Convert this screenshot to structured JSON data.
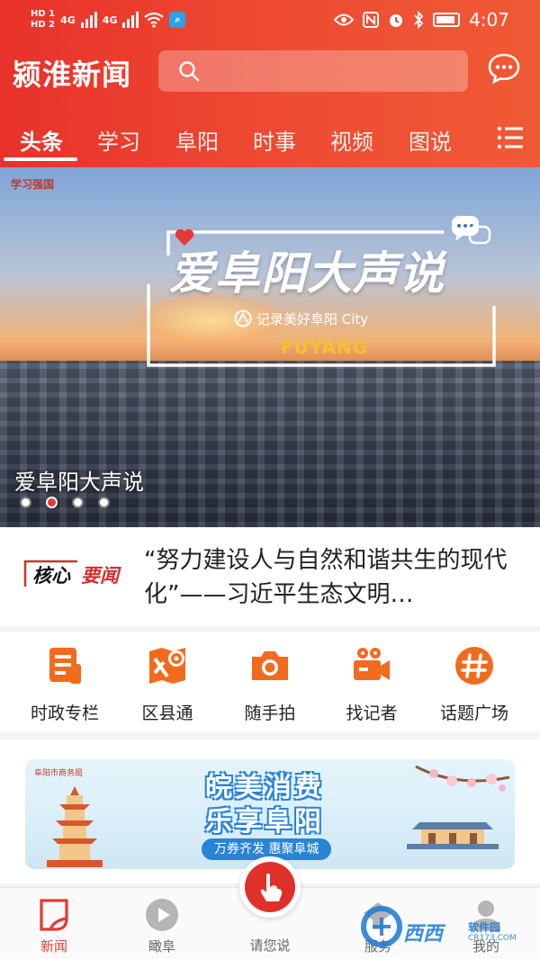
{
  "status_bar": {
    "hd1": "HD 1",
    "hd2": "HD 2",
    "net1": "4G",
    "net2": "4G",
    "time": "4:07"
  },
  "header": {
    "logo": "颍淮新闻",
    "search_placeholder": "",
    "tabs": [
      "头条",
      "学习",
      "阜阳",
      "时事",
      "视频",
      "图说"
    ],
    "active_tab": "头条"
  },
  "banner": {
    "brand": "学习强国",
    "title": "爱阜阳大声说",
    "subtitle": "记录美好阜阳 City",
    "english": "FUYANG",
    "caption": "爱阜阳大声说",
    "slides": 4,
    "active_slide": 2
  },
  "core_news": {
    "badge_left": "核心",
    "badge_right": "要闻",
    "headline": "“努力建设人与自然和谐共生的现代化”——习近平生态文明…"
  },
  "quick_nav": [
    {
      "label": "时政专栏",
      "icon": "document-icon"
    },
    {
      "label": "区县通",
      "icon": "map-pin-icon"
    },
    {
      "label": "随手拍",
      "icon": "camera-icon"
    },
    {
      "label": "找记者",
      "icon": "video-camera-icon"
    },
    {
      "label": "话题广场",
      "icon": "hashtag-icon"
    }
  ],
  "ad": {
    "tag": "阜阳市商务局",
    "title_line1": "皖美消费",
    "title_line2": "乐享阜阳",
    "pill": "万券齐发 惠聚阜城"
  },
  "bottom_nav": {
    "items": [
      {
        "label": "新闻",
        "icon": "news-icon",
        "active": true
      },
      {
        "label": "瞰阜",
        "icon": "play-icon",
        "active": false
      },
      {
        "label": "服务",
        "icon": "service-icon",
        "active": false
      },
      {
        "label": "我的",
        "icon": "user-icon",
        "active": false
      }
    ],
    "center_label": "请您说"
  },
  "watermark": {
    "main": "西西",
    "small": "软件园",
    "url": "CR173.COM"
  },
  "colors": {
    "brand_red": "#e8312a",
    "accent_orange": "#f26b1d",
    "link_blue": "#2a84d6"
  }
}
